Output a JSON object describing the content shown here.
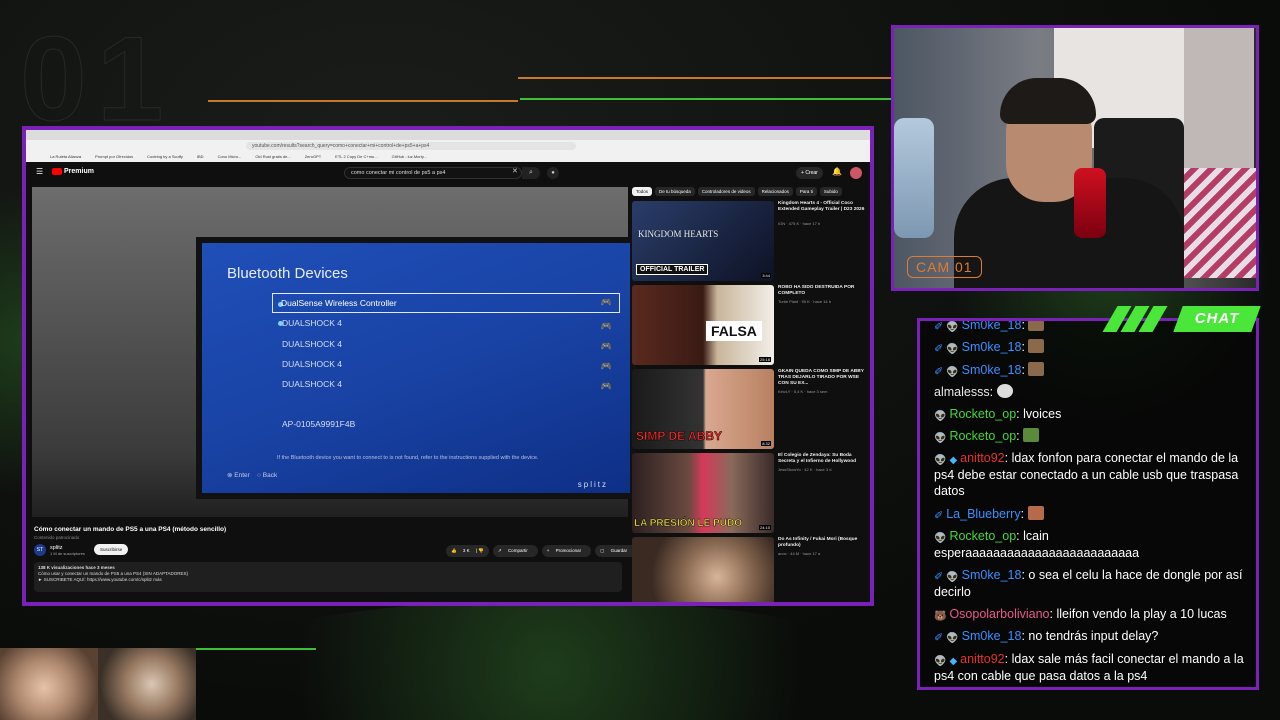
{
  "overlay": {
    "bg_number": "01",
    "cam_label": "CAM 01",
    "chat_label": "CHAT"
  },
  "browser": {
    "url": "youtube.com/results?search_query=como+conectar+mi+control+de+ps5+a+ps4",
    "bookmarks": [
      "La Ruleta Alianza",
      "Prompt por Ofrecidos",
      "Codeing by a Scuffy",
      "IBD",
      "Cono Micro...",
      "Old Rust gratis de...",
      "ZeroGPT",
      "ETL 2 Copy De C+mu...",
      "GitHub - luz.Morty..."
    ]
  },
  "youtube": {
    "logo": "Premium",
    "search_query": "como conectar mi control de ps5 a ps4",
    "create_label": "Crear",
    "video": {
      "title": "Cómo conectar un mando de PS5 a una PS4 (método sencillo)",
      "sub": "Contenido patrocinado",
      "channel": "splitz",
      "channel_avatar": "ST",
      "subscribers": "1 M de suscriptores",
      "subscribe": "Suscribirse",
      "likes": "3 K",
      "share": "Compartir",
      "promote": "Promocionar",
      "save": "Guardar",
      "views": "138 K visualizaciones  hace 3 meses",
      "desc1": "Cómo usar y conectar un mando de PS5 a una PS4 (SIN ADAPTADORES)",
      "desc2": "► SUSCRIBETE AQUÍ: https://www.youtube.com/c/splitz   más"
    },
    "ps4": {
      "title": "Bluetooth Devices",
      "devices": [
        "DualSense Wireless Controller",
        "DUALSHOCK 4",
        "DUALSHOCK 4",
        "DUALSHOCK 4",
        "DUALSHOCK 4"
      ],
      "mac": "AP-0105A9991F4B",
      "footer": "If the Bluetooth device you want to connect to is not found, refer to the instructions supplied with the device.",
      "enter": "Enter",
      "back": "Back",
      "watermark": "splitz"
    },
    "chips": [
      "Todos",
      "De tu búsqueda",
      "Controladores de videos",
      "Relacionados",
      "Para ti",
      "Subido"
    ],
    "recs": [
      {
        "title": "Kingdom Hearts 4 - Official Coco Extended Gameplay Trailer | D23 2026",
        "meta": "IGN · 475 K · hace 17 h",
        "overlay": "OFFICIAL TRAILER",
        "duration": "3:44",
        "thumb_text": "KINGDOM HEARTS"
      },
      {
        "title": "ROBO HA SIDO DESTRUIDA POR COMPLETO",
        "meta": "Turtie Plaid · 95 K · hace 14 h",
        "overlay": "FALSA",
        "duration": "25:18"
      },
      {
        "title": "GKAIN QUEDA COMO SIMP DE ABBY TRAS DEJARLO TIRADO POR WSE CON SU EX...",
        "meta": "KeivLY · 5,4 K · hace 3 sem",
        "overlay": "SIMP DE ABBY",
        "duration": "8:32"
      },
      {
        "title": "El Colegio de Zendaya: Su Boda Secreta y el Infierno de Hollywood",
        "meta": "JessShowYo · 42 K · hace 3 d",
        "overlay": "LA PRESIÓN LE PUDO",
        "duration": "24:10"
      },
      {
        "title": "Do As Infinity / Fukai Mori (Bosque profundo)",
        "meta": "anoc · 44 M · hace 17 a",
        "overlay": "",
        "duration": ""
      }
    ]
  },
  "chat": {
    "messages": [
      {
        "user": "Sm0ke_18",
        "text": "",
        "color": "blue"
      },
      {
        "user": "Sm0ke_18",
        "text": "",
        "color": "blue"
      },
      {
        "user": "almalesss",
        "text": "",
        "color": "gray"
      },
      {
        "user": "Rocketo_op",
        "text": "lvoices",
        "color": "green"
      },
      {
        "user": "Rocketo_op",
        "text": "",
        "color": "green"
      },
      {
        "user": "anitto92",
        "text": "ldax fonfon para conectar el mando de la ps4 debe estar conectado a un cable usb que traspasa datos",
        "color": "red"
      },
      {
        "user": "La_Blueberry",
        "text": "",
        "color": "blue"
      },
      {
        "user": "Rocketo_op",
        "text": "lcain esperaaaaaaaaaaaaaaaaaaaaaaaaa",
        "color": "green"
      },
      {
        "user": "Sm0ke_18",
        "text": "o sea el celu la hace de dongle por así decirlo",
        "color": "blue"
      },
      {
        "user": "Osopolarboliviano",
        "text": "lleifon vendo la play a 10 lucas",
        "color": "pink"
      },
      {
        "user": "Sm0ke_18",
        "text": "no tendrás input delay?",
        "color": "blue"
      },
      {
        "user": "anitto92",
        "text": "ldax sale más facil conectar el mando a la ps4 con cable que pasa datos a la ps4",
        "color": "red"
      }
    ]
  }
}
